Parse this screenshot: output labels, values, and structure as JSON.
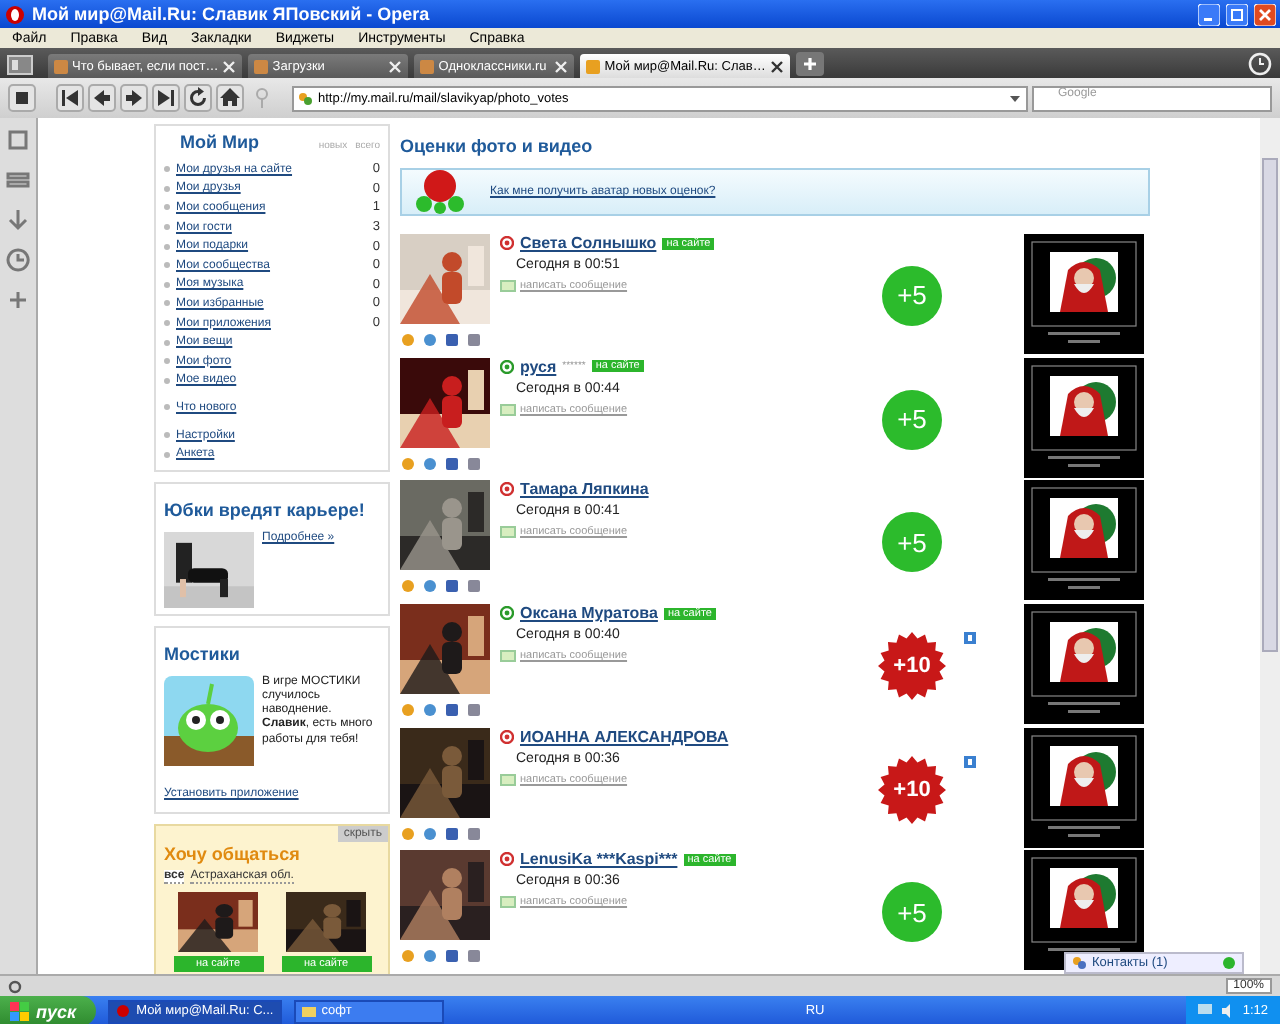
{
  "window": {
    "title": "Мой мир@Mail.Ru: Славик ЯПовский - Opera"
  },
  "menu": [
    "Файл",
    "Правка",
    "Вид",
    "Закладки",
    "Виджеты",
    "Инструменты",
    "Справка"
  ],
  "tabs": [
    {
      "label": "Что бывает, если пост…",
      "selected": false
    },
    {
      "label": "Загрузки",
      "selected": false
    },
    {
      "label": "Одноклассники.ru",
      "selected": false
    },
    {
      "label": "Мой мир@Mail.Ru: Слав…",
      "selected": true
    }
  ],
  "address": {
    "url": "http://my.mail.ru/mail/slavikyap/photo_votes",
    "search_placeholder": "Google"
  },
  "sidebar": {
    "title": "Мой Мир",
    "columns": [
      "новых",
      "всего"
    ],
    "groups": [
      [
        {
          "label": "Мои друзья на сайте",
          "count": "0"
        },
        {
          "label": "Мои друзья",
          "count": "0"
        },
        {
          "label": "Мои сообщения",
          "count": "1"
        },
        {
          "label": "Мои гости",
          "count": "3"
        },
        {
          "label": "Мои подарки",
          "count": "0"
        },
        {
          "label": "Мои сообщества",
          "count": "0"
        },
        {
          "label": "Моя музыка",
          "count": "0"
        },
        {
          "label": "Мои избранные",
          "count": "0"
        },
        {
          "label": "Мои приложения",
          "count": "0"
        },
        {
          "label": "Мои вещи"
        },
        {
          "label": "Мои фото"
        },
        {
          "label": "Мое видео"
        }
      ],
      [
        {
          "label": "Что нового"
        }
      ],
      [
        {
          "label": "Настройки"
        },
        {
          "label": "Анкета"
        }
      ]
    ]
  },
  "ad": {
    "title": "Юбки вредят карьере!",
    "link": "Подробнее »"
  },
  "game": {
    "title": "Мостики",
    "text": "В игре МОСТИКИ случилось наводнение. **Славик**, есть много работы для тебя!",
    "link": "Установить приложение"
  },
  "chat": {
    "hide": "скрыть",
    "title": "Хочу общаться",
    "filters": [
      {
        "label": "все",
        "selected": true
      },
      {
        "label": "Астраханская обл.",
        "selected": false
      }
    ],
    "people": [
      {
        "status": "на сайте"
      },
      {
        "status": "на сайте"
      }
    ]
  },
  "main": {
    "title": "Оценки фото и видео",
    "banner_link": "Как мне получить аватар новых оценок?",
    "votes": [
      {
        "name": "Света Солнышко",
        "agent_online": false,
        "online": true,
        "online_label": "на сайте",
        "time": "Сегодня в 00:51",
        "write_label": "написать сообщение",
        "kind": "plus",
        "score": "+5"
      },
      {
        "name": "руся",
        "extra": "******",
        "agent_online": true,
        "online": true,
        "online_label": "на сайте",
        "time": "Сегодня в 00:44",
        "write_label": "написать сообщение",
        "kind": "plus",
        "score": "+5"
      },
      {
        "name": "Тамара Ляпкина",
        "agent_online": false,
        "online": false,
        "time": "Сегодня в 00:41",
        "write_label": "написать сообщение",
        "kind": "plus",
        "score": "+5"
      },
      {
        "name": "Оксана Муратова",
        "agent_online": true,
        "online": true,
        "online_label": "на сайте",
        "time": "Сегодня в 00:40",
        "write_label": "написать сообщение",
        "kind": "star",
        "score": "+10"
      },
      {
        "name": "ИОАННА АЛЕКСАНДРОВА",
        "agent_online": false,
        "online": false,
        "time": "Сегодня в 00:36",
        "write_label": "написать сообщение",
        "kind": "star",
        "score": "+10"
      },
      {
        "name": "LenusiKa ***Kaspi***",
        "agent_online": false,
        "online": true,
        "online_label": "на сайте",
        "time": "Сегодня в 00:36",
        "write_label": "написать сообщение",
        "kind": "plus",
        "score": "+5"
      }
    ]
  },
  "contacts": {
    "label": "Контакты (1)"
  },
  "status": {
    "zoom": "100%"
  },
  "taskbar": {
    "start": "пуск",
    "tasks": [
      {
        "label": "Мой мир@Mail.Ru: С...",
        "selected": true
      },
      {
        "label": "софт",
        "selected": false
      }
    ],
    "lang": "RU",
    "clock": "1:12"
  }
}
